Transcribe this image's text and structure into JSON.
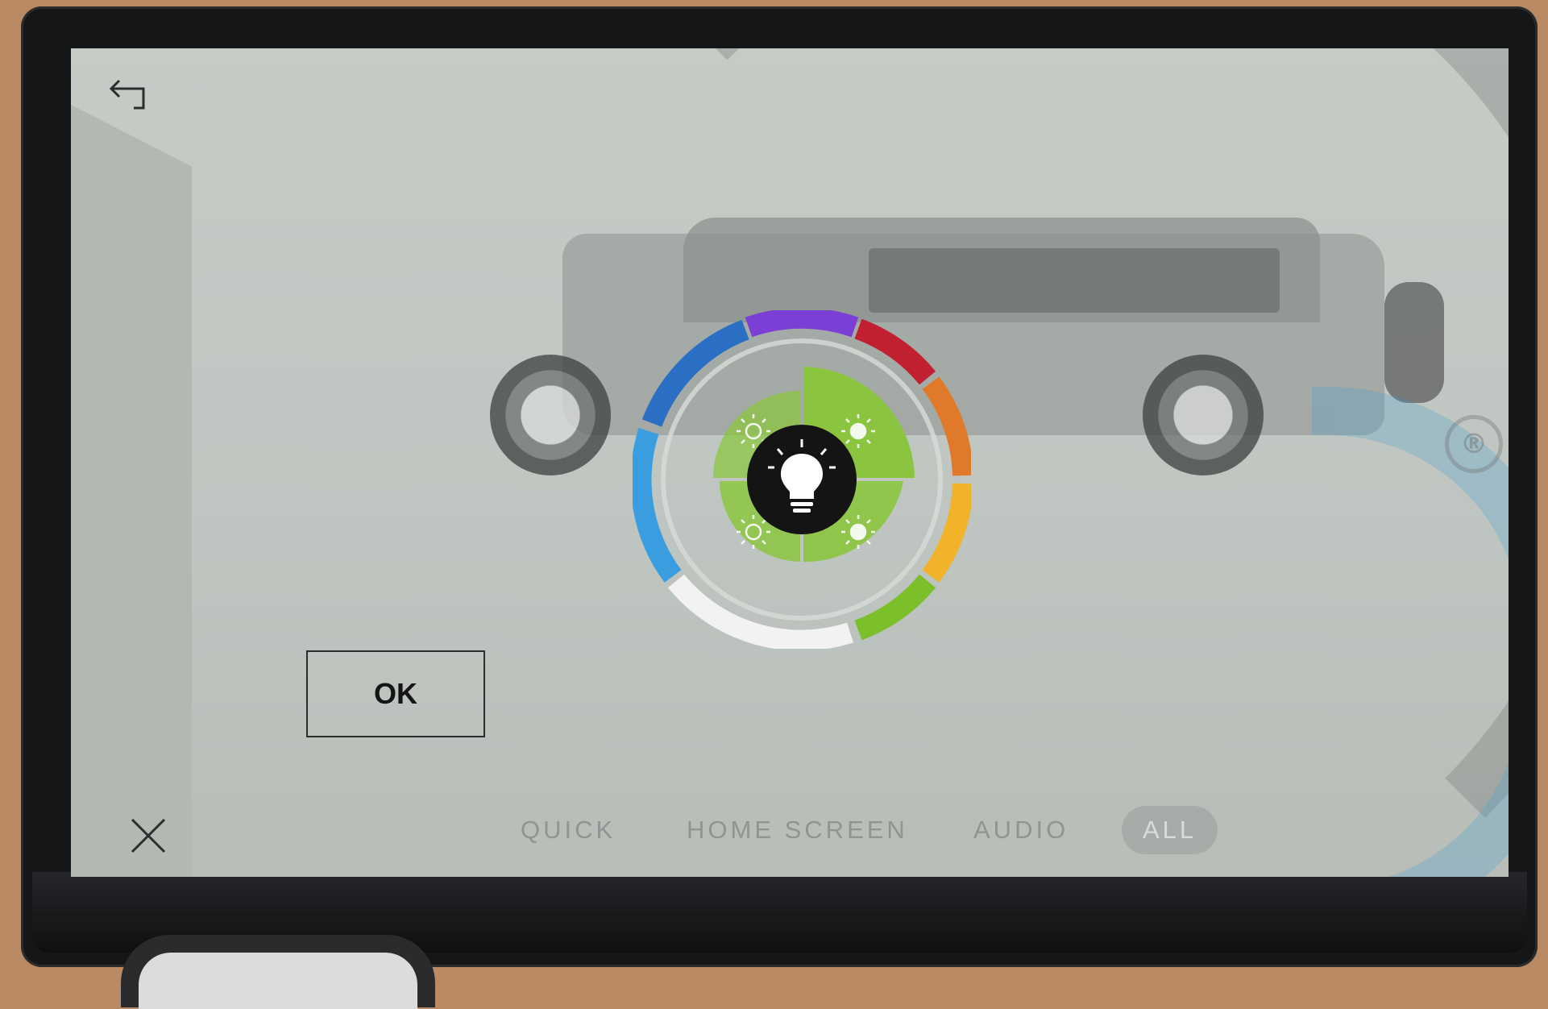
{
  "screen": {
    "ok_label": "OK",
    "tabs": [
      {
        "label": "QUICK",
        "active": false
      },
      {
        "label": "HOME SCREEN",
        "active": false
      },
      {
        "label": "AUDIO",
        "active": false
      },
      {
        "label": "ALL",
        "active": true
      }
    ],
    "icons": {
      "back": "back-arrow-icon",
      "close": "close-icon",
      "center": "light-bulb-icon",
      "quadrants": [
        "brightness-low-icon",
        "brightness-high-icon",
        "brightness-low-icon",
        "brightness-high-icon"
      ]
    },
    "colors": {
      "ring": [
        "#7b3fd6",
        "#c0202f",
        "#e07a2a",
        "#f0b32a",
        "#7bbf2a",
        "#f2f2f2",
        "#3a9de0",
        "#2a6fc4"
      ],
      "inner_green": "#8bc53f",
      "center": "#141414"
    }
  }
}
